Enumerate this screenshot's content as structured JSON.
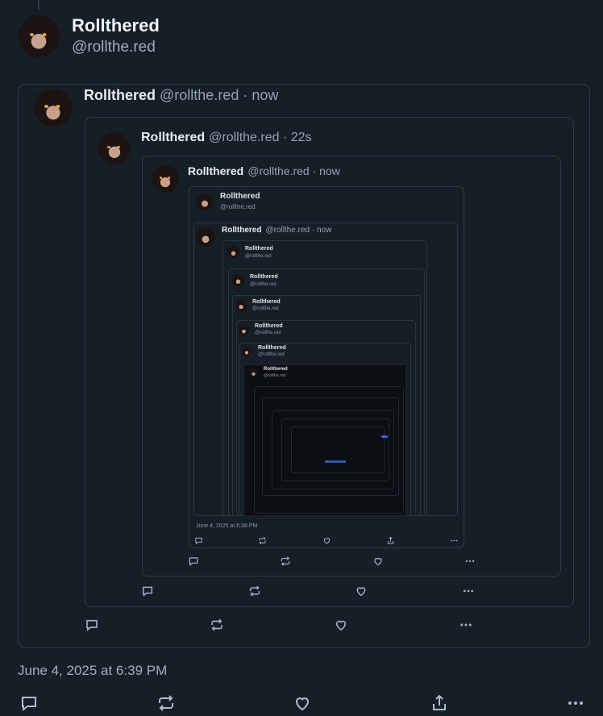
{
  "author": {
    "name": "Rollthered",
    "handle": "@rollthe.red"
  },
  "quote1": {
    "name": "Rollthered",
    "meta": "@rollthe.red · now"
  },
  "quote2": {
    "name": "Rollthered",
    "meta": "@rollthe.red · 22s"
  },
  "quote3": {
    "name": "Rollthered",
    "meta": "@rollthe.red · now"
  },
  "quote4": {
    "name": "Rollthered",
    "handle": "@rollthe.red"
  },
  "quote5": {
    "name": "Rollthered",
    "meta": "@rollthe.red · now"
  },
  "nested": [
    {
      "name": "Rollthered",
      "handle": "@rollthe.red"
    },
    {
      "name": "Rollthered",
      "handle": "@rollthe.red"
    },
    {
      "name": "Rollthered",
      "handle": "@rollthe.red"
    },
    {
      "name": "Rollthered",
      "handle": "@rollthe.red"
    },
    {
      "name": "Rollthered",
      "handle": "@rollthe.red"
    },
    {
      "name": "Rollthered",
      "handle": "@rollthe.red"
    }
  ],
  "inner_date": "June 4, 2025 at 6:38 PM",
  "post_date": "June 4, 2025 at 6:39 PM",
  "icons": [
    "reply-icon",
    "repost-icon",
    "like-icon",
    "share-icon",
    "more-icon"
  ],
  "colors": {
    "background": "#161e27",
    "border": "#2e3a48",
    "muted": "#a0aebd"
  }
}
